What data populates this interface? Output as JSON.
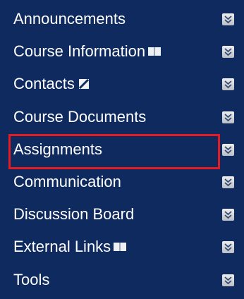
{
  "menu": {
    "items": [
      {
        "label": "Announcements",
        "icon": null
      },
      {
        "label": "Course Information",
        "icon": "book-icon"
      },
      {
        "label": "Contacts",
        "icon": "no-entry-icon"
      },
      {
        "label": "Course Documents",
        "icon": null
      },
      {
        "label": "Assignments",
        "icon": null,
        "highlighted": true
      },
      {
        "label": "Communication",
        "icon": null
      },
      {
        "label": "Discussion Board",
        "icon": null
      },
      {
        "label": "External Links",
        "icon": "book-icon"
      },
      {
        "label": "Tools",
        "icon": null
      }
    ],
    "expand_icon": "double-chevron-down-icon"
  },
  "colors": {
    "menu_background": "#0e2a5f",
    "menu_text": "#ffffff",
    "highlight_border": "#e31b23"
  }
}
